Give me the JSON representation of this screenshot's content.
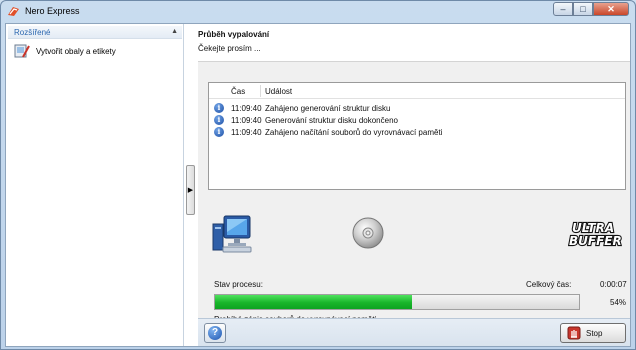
{
  "window": {
    "title": "Nero Express"
  },
  "sidebar": {
    "header": "Rozšířené",
    "items": [
      {
        "label": "Vytvořit obaly a etikety"
      }
    ]
  },
  "main": {
    "title": "Průběh vypalování",
    "subtitle": "Čekejte prosím ..."
  },
  "log": {
    "columns": [
      "Čas",
      "Událost"
    ],
    "rows": [
      {
        "time": "11:09:40",
        "event": "Zahájeno generování struktur disku"
      },
      {
        "time": "11:09:40",
        "event": "Generování struktur disku dokončeno"
      },
      {
        "time": "11:09:40",
        "event": "Zahájeno načítání souborů do vyrovnávací paměti"
      }
    ]
  },
  "status": {
    "label": "Stav procesu:",
    "total_label": "Celkový čas:",
    "total_value": "0:00:07",
    "percent_text": "54%",
    "percent": 54,
    "message": "Probíhá zápis souborů do vyrovnávací paměti"
  },
  "buttons": {
    "stop": "Stop"
  },
  "colors": {
    "progress": "#19b52a",
    "accent": "#2b67b0"
  }
}
